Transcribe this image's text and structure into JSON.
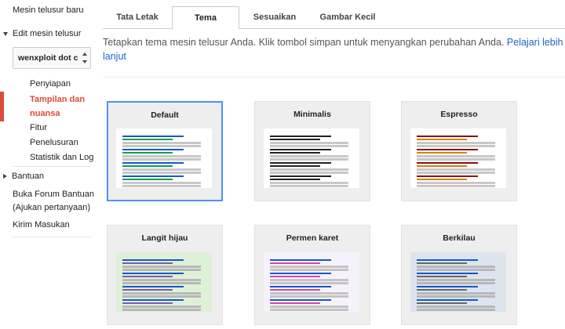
{
  "sidebar": {
    "new_engine": "Mesin telusur baru",
    "edit_engine": "Edit mesin telusur",
    "selected_engine": "wenxploit dot c",
    "subitems": [
      "Penyiapan",
      "Tampilan dan nuansa",
      "Fitur",
      "Penelusuran",
      "Statistik dan Log"
    ],
    "subitem_active_lines": [
      "Tampilan dan",
      "nuansa"
    ],
    "help": "Bantuan",
    "forum_lines": [
      "Buka Forum Bantuan",
      "(Ajukan pertanyaan)"
    ],
    "feedback": "Kirim Masukan"
  },
  "tabs": [
    "Tata Letak",
    "Tema",
    "Sesuaikan",
    "Gambar Kecil"
  ],
  "active_tab": "Tema",
  "intro": {
    "text": "Tetapkan tema mesin telusur Anda. Klik tombol simpan untuk menyangkan perubahan Anda. ",
    "link": "Pelajari lebih lanjut"
  },
  "themes": [
    {
      "name": "Default",
      "selected": true,
      "bg": "#ffffff",
      "title": "#1558c6",
      "url": "#0f9d58",
      "snippet": "#c8c8c8"
    },
    {
      "name": "Minimalis",
      "selected": false,
      "bg": "#ffffff",
      "title": "#222222",
      "url": "#222222",
      "snippet": "#c8c8c8"
    },
    {
      "name": "Espresso",
      "selected": false,
      "bg": "#ffffff",
      "title": "#8b1010",
      "url": "#d4820a",
      "snippet": "#c8c8c8"
    },
    {
      "name": "Langit hijau",
      "selected": false,
      "bg": "#dff0d8",
      "title": "#1558c6",
      "url": "#7a5ab8",
      "snippet": "#b8b8b8"
    },
    {
      "name": "Permen karet",
      "selected": false,
      "bg": "#f6f2fb",
      "title": "#1558c6",
      "url": "#d04aa8",
      "snippet": "#c4c4c4"
    },
    {
      "name": "Berkilau",
      "selected": false,
      "bg": "#dde4ee",
      "title": "#1558c6",
      "url": "#666666",
      "snippet": "#b8b8b8"
    }
  ]
}
